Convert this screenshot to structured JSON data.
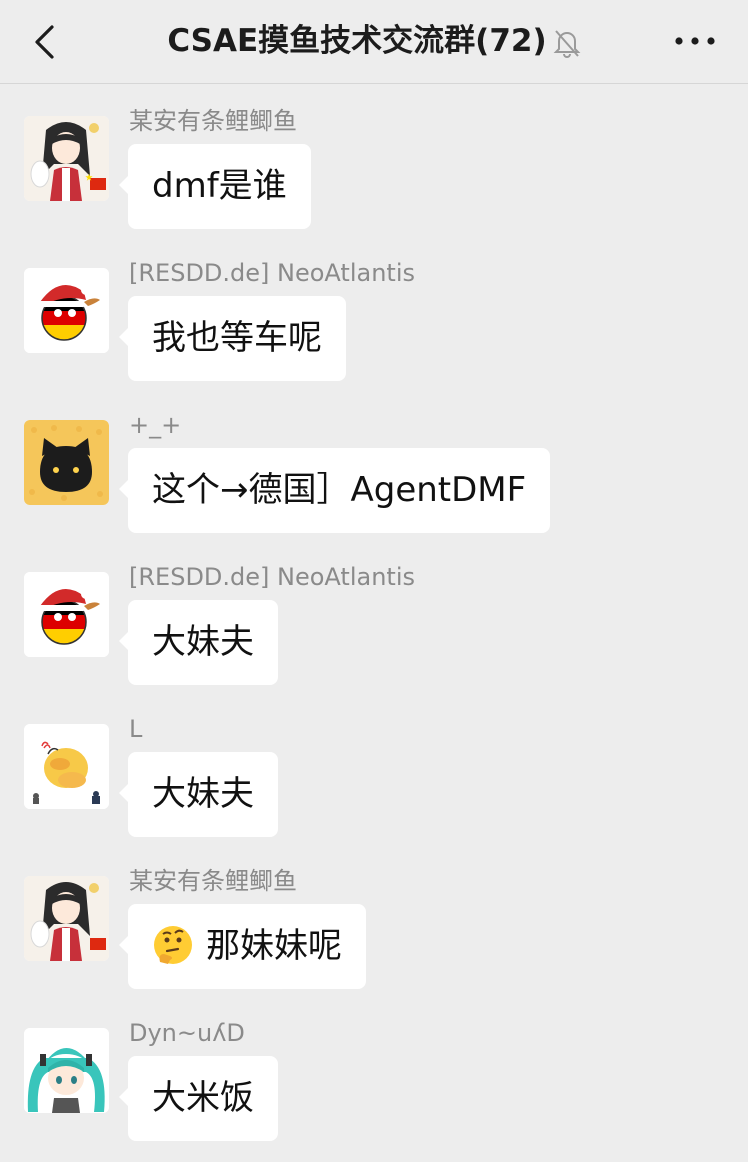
{
  "header": {
    "title": "CSAE摸鱼技术交流群(72)"
  },
  "messages": [
    {
      "sender": "某安有条鲤鲫鱼",
      "text": "dmf是谁",
      "avatar": "anime-girl-avatar"
    },
    {
      "sender": "[RESDD.de] NeoAtlantis",
      "text": "我也等车呢",
      "avatar": "germany-ball-avatar"
    },
    {
      "sender": "+_+",
      "text": "这个→德国］AgentDMF",
      "avatar": "black-cat-avatar"
    },
    {
      "sender": "[RESDD.de] NeoAtlantis",
      "text": "大妹夫",
      "avatar": "germany-ball-avatar"
    },
    {
      "sender": "L",
      "text": "大妹夫",
      "avatar": "psyduck-avatar"
    },
    {
      "sender": "某安有条鲤鲫鱼",
      "text": "那妹妹呢",
      "emoji": "thinking-face-emoji",
      "avatar": "anime-girl-avatar"
    },
    {
      "sender": "Dyn~uʎD",
      "text": "大米饭",
      "avatar": "miku-avatar"
    }
  ],
  "colors": {
    "background": "#ededed",
    "bubble": "#ffffff",
    "sender_text": "#8a8a8a",
    "german_black": "#000000",
    "german_red": "#dd0000",
    "german_gold": "#ffce00",
    "miku_teal": "#39c5bb"
  }
}
